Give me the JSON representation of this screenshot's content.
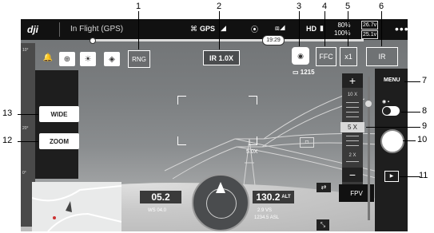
{
  "topbar": {
    "status": "In Flight (GPS)",
    "gps_label": "GPS",
    "hd_label": "HD",
    "battery_top": "80%",
    "battery_bottom": "100%",
    "volt_top": "26.7v",
    "volt_bottom": "25.1v",
    "more": "•••",
    "time": "19:29"
  },
  "toolbar": {
    "rng": "RNG",
    "ir_zoom": "IR 1.0X",
    "ffc": "FFC",
    "x1": "x1",
    "ir": "IR",
    "photo_count": "1215"
  },
  "left": {
    "wide": "WIDE",
    "zoom": "ZOOM",
    "level_top": "10°",
    "level_mid": "20°",
    "level_bottom": "0°"
  },
  "scene": {
    "zoom_text": "5.0X"
  },
  "zoom_scale": {
    "plus": "+",
    "minus": "−",
    "label_10x": "10 X",
    "label_5x": "5 X",
    "label_2x": "2 X",
    "fpv": "FPV"
  },
  "right": {
    "menu": "MENU",
    "play": "▶"
  },
  "telemetry": {
    "left_value": "05.2",
    "left_sub": "WS 04.0",
    "right_value": "130.2",
    "right_unit": "ALT",
    "right_sub1": "2.9 VS",
    "right_sub2": "1234.5 ASL"
  },
  "callouts": [
    "1",
    "2",
    "3",
    "4",
    "5",
    "6",
    "7",
    "8",
    "9",
    "10",
    "11",
    "12",
    "13"
  ]
}
